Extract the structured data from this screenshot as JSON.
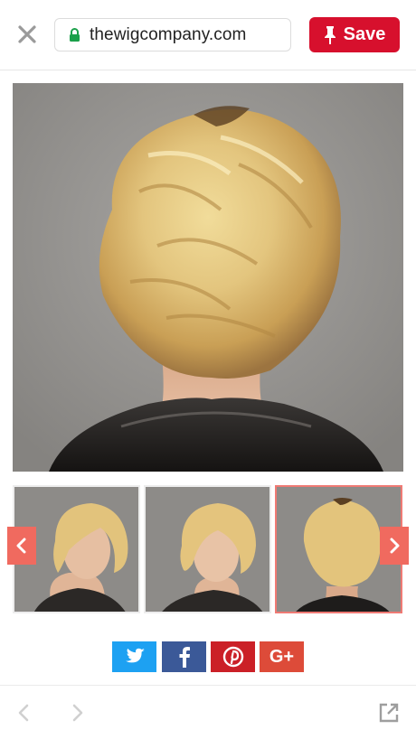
{
  "topbar": {
    "close_icon": "close-icon",
    "url": "thewigcompany.com",
    "lock_icon": "lock-icon",
    "save_label": "Save",
    "save_icon": "pin-icon",
    "save_color": "#d7102d"
  },
  "main_image": {
    "description_icon": "hairstyle-photo-back-view"
  },
  "gallery": {
    "prev_icon": "chevron-left-icon",
    "next_icon": "chevron-right-icon",
    "arrow_color": "#f06a5f",
    "active_index": 2,
    "thumbnails": [
      {
        "name": "thumbnail-side-view"
      },
      {
        "name": "thumbnail-front-view"
      },
      {
        "name": "thumbnail-back-view"
      }
    ]
  },
  "share": {
    "buttons": [
      {
        "icon": "twitter-icon",
        "color": "#1da1f2"
      },
      {
        "icon": "facebook-icon",
        "color": "#3b5998"
      },
      {
        "icon": "pinterest-icon",
        "color": "#cb2027"
      },
      {
        "icon": "google-plus-icon",
        "color": "#dd4b39",
        "label": "G+"
      }
    ]
  },
  "bottom_nav": {
    "back_icon": "back-arrow-icon",
    "forward_icon": "forward-arrow-icon",
    "open_external_icon": "open-external-icon"
  }
}
